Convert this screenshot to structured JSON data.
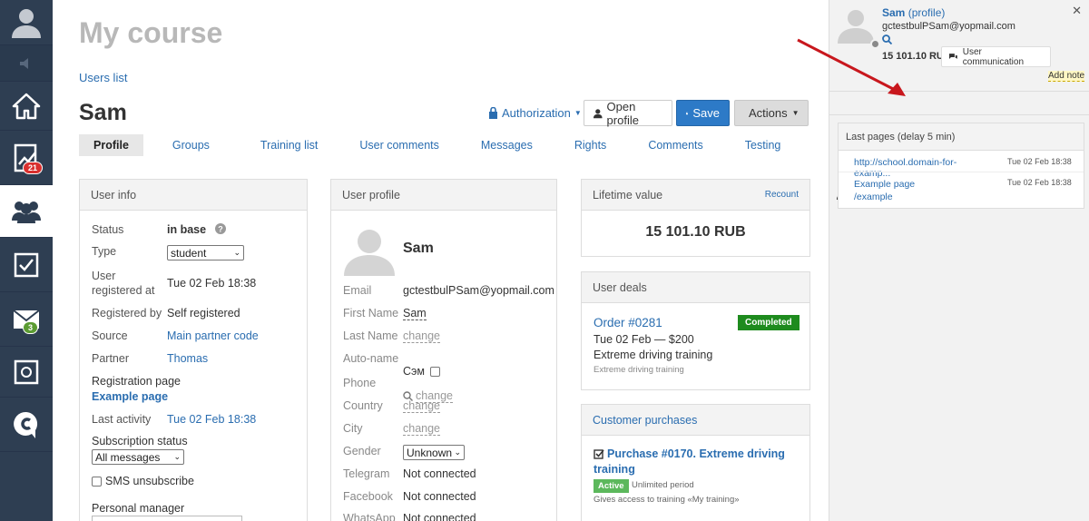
{
  "nav": {
    "items": [
      {
        "name": "profile"
      },
      {
        "name": "sound"
      },
      {
        "name": "home"
      },
      {
        "name": "stats",
        "badge": "21"
      },
      {
        "name": "users"
      },
      {
        "name": "tasks"
      },
      {
        "name": "messages",
        "badge": "3"
      },
      {
        "name": "safe"
      },
      {
        "name": "brand"
      }
    ],
    "badge_red": "#d9302f",
    "badge_green": "#5b9b32"
  },
  "header": {
    "title": "My course",
    "breadcrumb": "Users list",
    "user_name": "Sam"
  },
  "toolbar": {
    "authorization": "Authorization",
    "open_profile": "Open profile",
    "save": "Save",
    "actions": "Actions"
  },
  "tabs": [
    "Profile",
    "Groups",
    "Training list",
    "User comments",
    "Messages",
    "Rights",
    "Comments",
    "Testing"
  ],
  "user_info": {
    "title": "User info",
    "status_label": "Status",
    "status_value": "in base",
    "type_label": "Type",
    "type_value": "student",
    "registered_label1": "User",
    "registered_label2": "registered at",
    "registered_value": "Tue 02 Feb 18:38",
    "registered_by_label": "Registered by",
    "registered_by_value": "Self registered",
    "source_label": "Source",
    "source_value": "Main partner code",
    "partner_label": "Partner",
    "partner_value": "Thomas",
    "reg_page_label": "Registration page",
    "reg_page_value": "Example page",
    "last_activity_label": "Last activity",
    "last_activity_value": "Tue 02 Feb 18:38",
    "subscription_label": "Subscription status",
    "subscription_value": "All messages",
    "sms_label": "SMS unsubscribe",
    "manager_label": "Personal manager"
  },
  "user_profile": {
    "title": "User profile",
    "name": "Sam",
    "email_label": "Email",
    "email_value": "gctestbulPSam@yopmail.com",
    "first_name_label": "First Name",
    "first_name_value": "Sam",
    "last_name_label": "Last Name",
    "change": "change",
    "autoname_label": "Auto-name",
    "autoname_value": "Сэм",
    "phone_label": "Phone",
    "country_label": "Country",
    "city_label": "City",
    "gender_label": "Gender",
    "gender_value": "Unknown",
    "telegram_label": "Telegram",
    "facebook_label": "Facebook",
    "whatsapp_label": "WhatsApp",
    "not_connected": "Not connected"
  },
  "ltv": {
    "title": "Lifetime value",
    "recount": "Recount",
    "value": "15 101.10 RUB"
  },
  "deals": {
    "title": "User deals",
    "order": "Order #0281",
    "status": "Completed",
    "date_price": "Tue 02 Feb — $200",
    "product": "Extreme driving training",
    "product_small": "Extreme driving training",
    "status_color": "#1e8b1e"
  },
  "purchases": {
    "title": "Customer purchases",
    "purchase": "Purchase #0170. Extreme driving training",
    "status": "Active",
    "period": "Unlimited period",
    "access": "Gives access to training «My training»",
    "status_color": "#5cb85c"
  },
  "side": {
    "name": "Sam",
    "profile_link": "(profile)",
    "email": "gctestbulPSam@yopmail.com",
    "amount": "15 101.10 RUB",
    "user_communication": "User communication",
    "add_note": "Add note",
    "last_pages_title": "Last pages (delay 5 min)",
    "pages": [
      {
        "url": "http://school.domain-for-examp...",
        "date": "Tue 02 Feb 18:38"
      },
      {
        "url": "Example page /example",
        "date": "Tue 02 Feb 18:38"
      }
    ],
    "arrow_color": "#c8171d"
  }
}
